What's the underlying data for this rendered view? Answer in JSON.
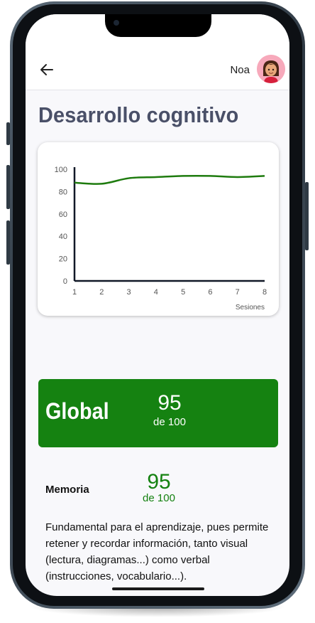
{
  "header": {
    "back_icon": "arrow-left-icon",
    "user_name": "Noa",
    "avatar_icon": "girl-avatar-icon"
  },
  "page": {
    "title": "Desarrollo cognitivo"
  },
  "chart_data": {
    "type": "line",
    "x": [
      1,
      2,
      3,
      4,
      5,
      6,
      7,
      8
    ],
    "series": [
      {
        "values": [
          88,
          87,
          92,
          93,
          94,
          94,
          93,
          94
        ],
        "color": "#1e7b0e"
      }
    ],
    "xlabel": "Sesiones",
    "ylabel": "",
    "xlim": [
      1,
      8
    ],
    "ylim": [
      0,
      100
    ],
    "yticks": [
      0,
      20,
      40,
      60,
      80,
      100
    ],
    "xticks": [
      1,
      2,
      3,
      4,
      5,
      6,
      7,
      8
    ],
    "grid": false
  },
  "global": {
    "label": "Global",
    "score": "95",
    "of": "de 100",
    "color": "#158211"
  },
  "memory": {
    "label": "Memoria",
    "score": "95",
    "of": "de 100",
    "description": "Fundamental para el aprendizaje, pues permite retener y recordar información, tanto visual (lectura, diagramas...) como verbal (instrucciones, vocabulario...)."
  }
}
